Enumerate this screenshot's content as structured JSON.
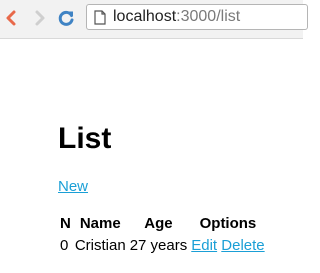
{
  "browser": {
    "url_host": "localhost",
    "url_rest": ":3000/list"
  },
  "page": {
    "title": "List",
    "new_link": "New",
    "table": {
      "headers": [
        "N",
        "Name",
        "Age",
        "Options"
      ],
      "rows": [
        {
          "n": "0",
          "name": "Cristian",
          "age": "27 years",
          "edit": "Edit",
          "delete": "Delete"
        }
      ]
    }
  },
  "colors": {
    "link": "#1a9fd6",
    "back_arrow": "#e8694a",
    "reload": "#3f83c4"
  }
}
